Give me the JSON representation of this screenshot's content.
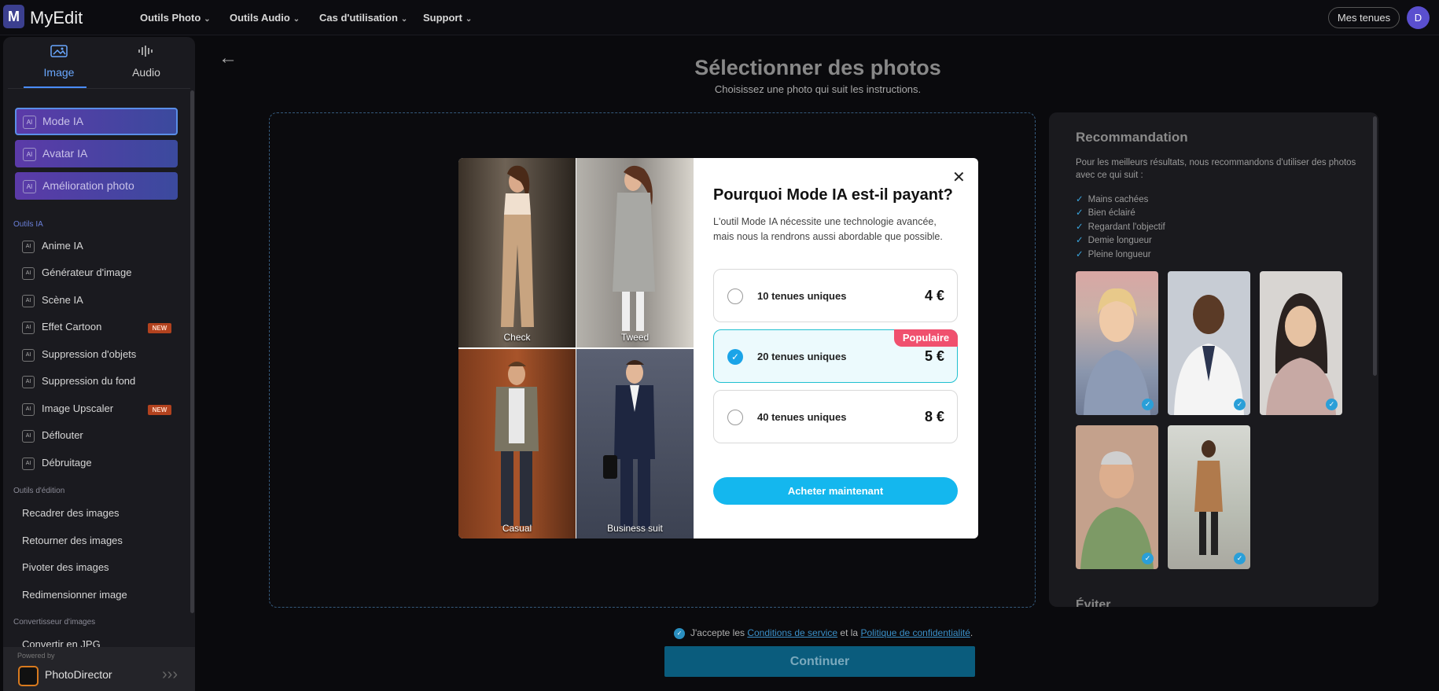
{
  "app": {
    "logo_letter": "M",
    "name": "MyEdit"
  },
  "topnav": {
    "items": [
      "Outils Photo",
      "Outils Audio",
      "Cas d'utilisation",
      "Support"
    ],
    "mes_tenues": "Mes tenues",
    "avatar_letter": "D"
  },
  "sidebar": {
    "tabs": [
      {
        "label": "Image"
      },
      {
        "label": "Audio"
      }
    ],
    "featured": [
      "Mode IA",
      "Avatar IA",
      "Amélioration photo"
    ],
    "ai_section": "Outils IA",
    "ai_items": [
      "Anime IA",
      "Générateur d'image",
      "Scène IA",
      "Effet Cartoon",
      "Suppression d'objets",
      "Suppression du fond",
      "Image Upscaler",
      "Déflouter",
      "Débruitage"
    ],
    "new_badge": "NEW",
    "edit_section": "Outils d'édition",
    "edit_items": [
      "Recadrer des images",
      "Retourner des images",
      "Pivoter des images",
      "Redimensionner image"
    ],
    "convert_section": "Convertisseur d'images",
    "convert_items": [
      "Convertir en JPG"
    ],
    "powered_by": "Powered by",
    "powered_name": "PhotoDirector"
  },
  "main": {
    "title": "Sélectionner des photos",
    "subtitle": "Choisissez une photo qui suit les instructions."
  },
  "recommendation": {
    "title": "Recommandation",
    "text": "Pour les meilleurs résultats, nous recommandons d'utiliser des photos avec ce qui suit :",
    "items": [
      "Mains cachées",
      "Bien éclairé",
      "Regardant l'objectif",
      "Demie longueur",
      "Pleine longueur"
    ],
    "avoid_title": "Éviter"
  },
  "consent": {
    "prefix": "J'accepte les",
    "terms": "Conditions de service",
    "middle": "et la",
    "privacy": "Politique de confidentialité",
    "suffix": "."
  },
  "continue_label": "Continuer",
  "modal": {
    "images": [
      "Check",
      "Tweed",
      "Casual",
      "Business suit"
    ],
    "title": "Pourquoi Mode IA est-il payant?",
    "description": "L'outil Mode IA nécessite une technologie avancée, mais nous la rendrons aussi abordable que possible.",
    "options": [
      {
        "label": "10 tenues uniques",
        "price": "4 €",
        "selected": false
      },
      {
        "label": "20 tenues uniques",
        "price": "5 €",
        "selected": true,
        "badge": "Populaire"
      },
      {
        "label": "40 tenues uniques",
        "price": "8 €",
        "selected": false
      }
    ],
    "buy_label": "Acheter maintenant"
  }
}
